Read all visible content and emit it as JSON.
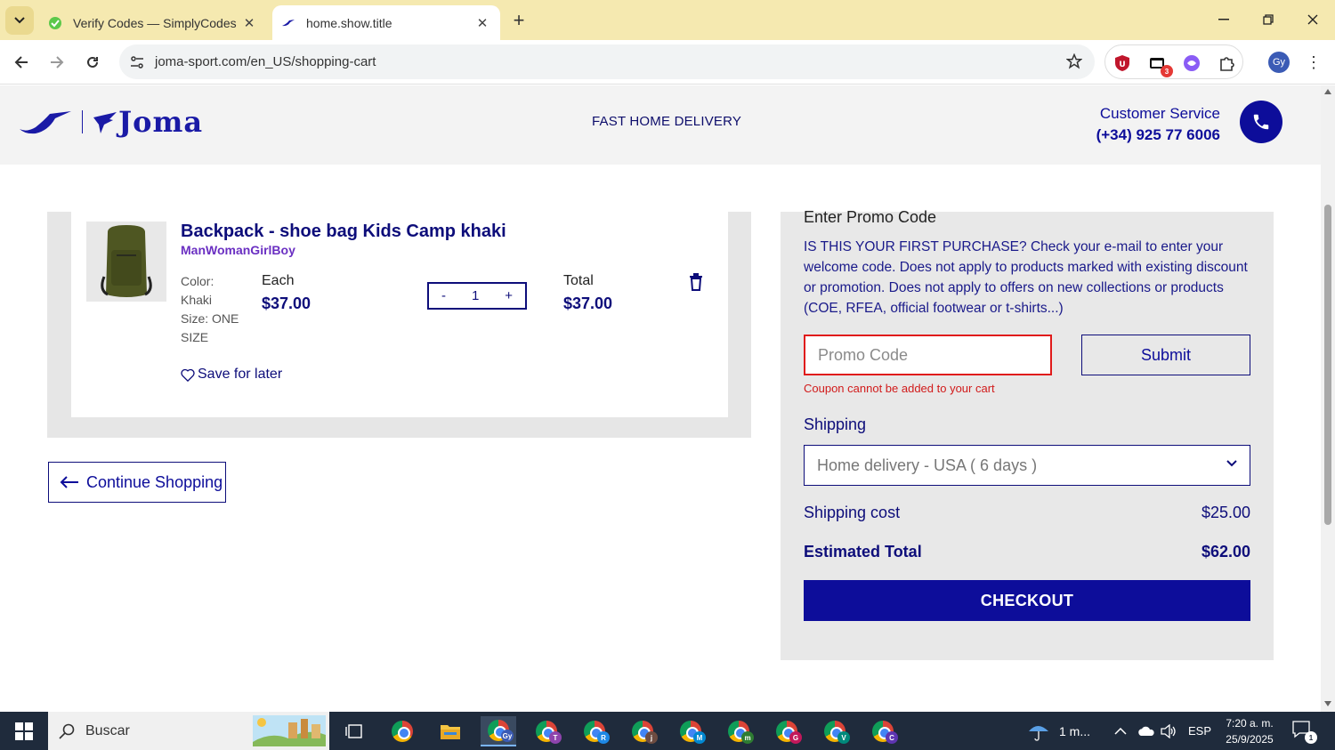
{
  "browser": {
    "tabs": [
      {
        "title": "Verify Codes — SimplyCodes",
        "active": false
      },
      {
        "title": "home.show.title",
        "active": true
      }
    ],
    "url": "joma-sport.com/en_US/shopping-cart",
    "extension_badge": "3",
    "profile_initials": "Gy"
  },
  "header": {
    "logo_text": "Joma",
    "delivery": "FAST HOME DELIVERY",
    "customer_service_label": "Customer Service",
    "customer_service_phone": "(+34) 925 77 6006"
  },
  "cart": {
    "item": {
      "name": "Backpack - shoe bag Kids Camp khaki",
      "gender": "ManWomanGirlBoy",
      "color_label": "Color:",
      "color_value": "Khaki",
      "size_label": "Size: ONE",
      "size_value": "SIZE",
      "each_label": "Each",
      "each_price": "$37.00",
      "quantity": "1",
      "qty_minus": "-",
      "qty_plus": "+",
      "total_label": "Total",
      "total_price": "$37.00",
      "save_for_later": "Save for later"
    },
    "continue_shopping": "Continue Shopping"
  },
  "summary": {
    "promo_title": "Enter Promo Code",
    "promo_note": "IS THIS YOUR FIRST PURCHASE? Check your e-mail to enter your welcome code. Does not apply to products marked with existing discount or promotion. Does not apply to offers on new collections or products (COE, RFEA, official footwear or t-shirts...)",
    "promo_placeholder": "Promo Code",
    "submit_label": "Submit",
    "promo_error": "Coupon cannot be added to your cart",
    "shipping_label": "Shipping",
    "shipping_option": "Home delivery - USA ( 6 days )",
    "shipping_cost_label": "Shipping cost",
    "shipping_cost_value": "$25.00",
    "estimated_total_label": "Estimated Total",
    "estimated_total_value": "$62.00",
    "checkout_label": "CHECKOUT"
  },
  "taskbar": {
    "search_placeholder": "Buscar",
    "weather": "1 m...",
    "language": "ESP",
    "time": "7:20 a. m.",
    "date": "25/9/2025",
    "notification_count": "1",
    "chrome_profiles": [
      "Gy",
      "T",
      "R",
      "j",
      "M",
      "m",
      "G",
      "V",
      "C"
    ]
  },
  "colors": {
    "brand_navy": "#0d0d9a",
    "error_red": "#e01b1b",
    "tabbar_bg": "#f5e9b0"
  }
}
